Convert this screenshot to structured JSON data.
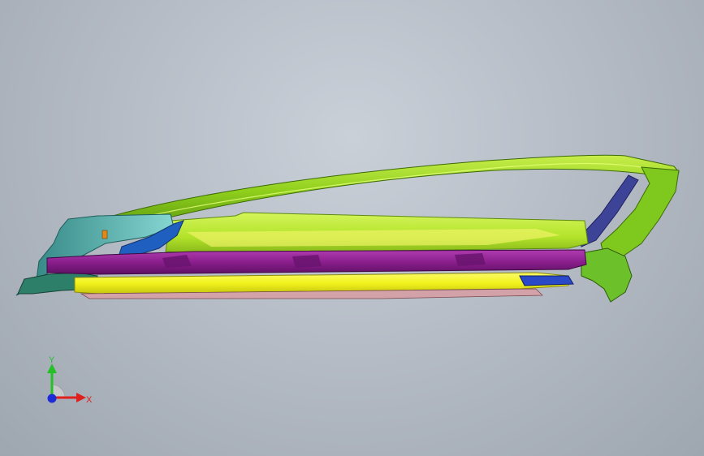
{
  "viewport": {
    "background": "#b6bdc6",
    "model_colors": {
      "roof_rail": "#9bd21e",
      "roof_rail_edge": "#4c7a0a",
      "sill_upper": "#b6e62b",
      "sill_purple": "#8a1f8c",
      "sill_yellow": "#f2f21c",
      "front_blue": "#1f5fbf",
      "front_teal": "#3fa7a7",
      "rear_navy": "#3a3f8f",
      "rear_green": "#6ec41a",
      "bottom_rose": "#d9a0a6"
    }
  },
  "triad": {
    "x_label": "X",
    "y_label": "Y",
    "x_color": "#e0201c",
    "y_color": "#24c028",
    "z_color": "#1c2bd8"
  }
}
